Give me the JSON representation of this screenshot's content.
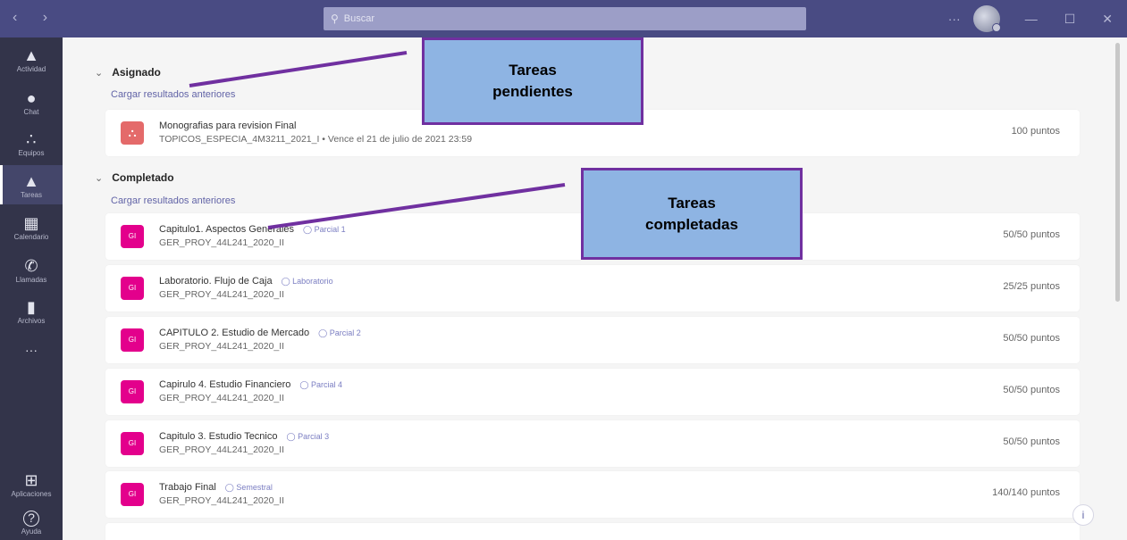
{
  "titlebar": {
    "nav": "‹ ›",
    "search_placeholder": "Buscar",
    "more": "···",
    "minimize": "—",
    "maximize": "☐",
    "close": "✕"
  },
  "rail": [
    {
      "label": "Actividad",
      "glyph": "🔔"
    },
    {
      "label": "Chat",
      "glyph": "💬"
    },
    {
      "label": "Equipos",
      "glyph": "👥"
    },
    {
      "label": "Tareas",
      "glyph": "🎒"
    },
    {
      "label": "Calendario",
      "glyph": "▦"
    },
    {
      "label": "Llamadas",
      "glyph": "✆"
    },
    {
      "label": "Archivos",
      "glyph": "▮"
    },
    {
      "label": "",
      "glyph": "···"
    },
    {
      "label": "Aplicaciones",
      "glyph": "⊞"
    },
    {
      "label": "Ayuda",
      "glyph": "?"
    }
  ],
  "assigned": {
    "heading": "Asignado",
    "load_previous": "Cargar resultados anteriores",
    "items": [
      {
        "title": "Monografias para revision Final",
        "subtitle": "TOPICOS_ESPECIA_4M3211_2021_I • Vence el 21 de julio de 2021 23:59",
        "points": "100 puntos"
      }
    ]
  },
  "completed": {
    "heading": "Completado",
    "load_previous": "Cargar resultados anteriores",
    "icon_text": "GI",
    "items": [
      {
        "title": "Capitulo1. Aspectos Generales",
        "tag": "Parcial 1",
        "subtitle": "GER_PROY_44L241_2020_II",
        "points": "50/50 puntos"
      },
      {
        "title": "Laboratorio. Flujo de Caja",
        "tag": "Laboratorio",
        "subtitle": "GER_PROY_44L241_2020_II",
        "points": "25/25 puntos"
      },
      {
        "title": "CAPITULO 2. Estudio de Mercado",
        "tag": "Parcial 2",
        "subtitle": "GER_PROY_44L241_2020_II",
        "points": "50/50 puntos"
      },
      {
        "title": "Capirulo 4. Estudio Financiero",
        "tag": "Parcial 4",
        "subtitle": "GER_PROY_44L241_2020_II",
        "points": "50/50 puntos"
      },
      {
        "title": "Capitulo 3. Estudio Tecnico",
        "tag": "Parcial 3",
        "subtitle": "GER_PROY_44L241_2020_II",
        "points": "50/50 puntos"
      },
      {
        "title": "Trabajo Final",
        "tag": "Semestral",
        "subtitle": "GER_PROY_44L241_2020_II",
        "points": "140/140 puntos"
      }
    ]
  },
  "callouts": {
    "pending": [
      "Tareas",
      "pendientes"
    ],
    "completed": [
      "Tareas",
      "completadas"
    ]
  },
  "colors": {
    "titlebar": "#494b83",
    "rail": "#33344a",
    "accent": "#6264a7",
    "assignment_icon": "#e3008c",
    "callout_fill": "#8eb4e3",
    "callout_border": "#7030a0"
  }
}
